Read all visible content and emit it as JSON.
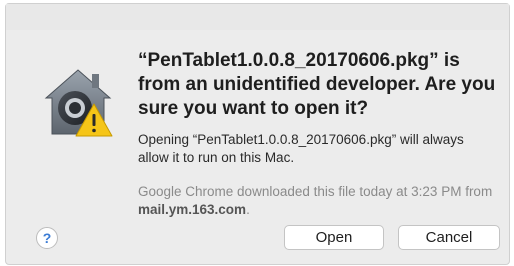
{
  "dialog": {
    "headline": "“PenTablet1.0.0.8_20170606.pkg” is from an unidentified developer. Are you sure you want to open it?",
    "body": "Opening “PenTablet1.0.0.8_20170606.pkg” will always allow it to run on this Mac.",
    "info_prefix": "Google Chrome downloaded this file today at 3:23 PM from ",
    "info_domain": "mail.ym.163.com",
    "info_suffix": ".",
    "icon": "gatekeeper-warning-icon"
  },
  "buttons": {
    "help_label": "?",
    "open_label": "Open",
    "cancel_label": "Cancel"
  },
  "colors": {
    "warning_yellow": "#f5c518",
    "lock_dark": "#3c4148",
    "help_blue": "#3a7bd5"
  }
}
